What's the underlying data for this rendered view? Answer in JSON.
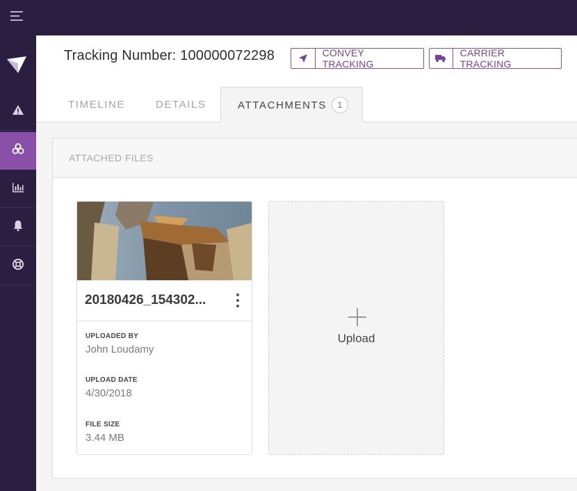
{
  "topbar": {
    "menu_icon": "hamburger-icon"
  },
  "sidebar": {
    "items": [
      {
        "name": "alert",
        "icon": "warning-icon",
        "active": false
      },
      {
        "name": "packages",
        "icon": "boxes-icon",
        "active": true
      },
      {
        "name": "reports",
        "icon": "bar-chart-icon",
        "active": false
      },
      {
        "name": "notifications",
        "icon": "bell-icon",
        "active": false
      },
      {
        "name": "support",
        "icon": "lifebuoy-icon",
        "active": false
      }
    ]
  },
  "header": {
    "tracking_title": "Tracking Number: 100000072298",
    "convey_tracking_label": "CONVEY TRACKING",
    "carrier_tracking_label": "CARRIER TRACKING"
  },
  "tabs": {
    "timeline": "TIMELINE",
    "details": "DETAILS",
    "attachments": "ATTACHMENTS",
    "attachments_count": "1",
    "active": "attachments"
  },
  "panel": {
    "title": "ATTACHED FILES",
    "files": [
      {
        "name": "20180426_154302...",
        "uploaded_by_label": "UPLOADED BY",
        "uploaded_by": "John Loudamy",
        "upload_date_label": "UPLOAD DATE",
        "upload_date": "4/30/2018",
        "file_size_label": "FILE SIZE",
        "file_size": "3.44 MB"
      }
    ],
    "upload_label": "Upload"
  },
  "colors": {
    "nav_bg": "#2a1f40",
    "accent": "#8a4fa9",
    "page_bg": "#f4f4f4"
  }
}
